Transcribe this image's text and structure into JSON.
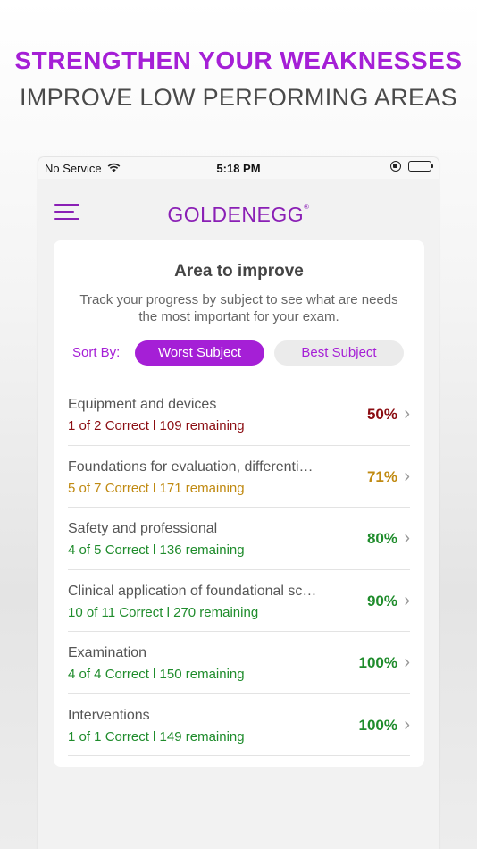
{
  "promo": {
    "headline": "STRENGTHEN YOUR WEAKNESSES",
    "subheadline": "IMPROVE LOW PERFORMING AREAS"
  },
  "status_bar": {
    "carrier": "No Service",
    "time": "5:18 PM"
  },
  "header": {
    "logo": "GOLDENEGG",
    "logo_mark": "®"
  },
  "card": {
    "title": "Area to improve",
    "description": "Track your progress by subject to see what are needs the most important for your exam.",
    "sort_label": "Sort By:",
    "sort_options": [
      "Worst Subject",
      "Best Subject"
    ],
    "selected_sort": "Worst Subject"
  },
  "subjects": [
    {
      "name": "Equipment and devices",
      "stats": "1 of 2  Correct l 109 remaining",
      "percent": "50%",
      "color": "#8b0d12"
    },
    {
      "name": "Foundations for evaluation, differenti…",
      "stats": "5 of 7  Correct l 171 remaining",
      "percent": "71%",
      "color": "#c08a12"
    },
    {
      "name": "Safety and professional",
      "stats": "4 of 5  Correct l 136 remaining",
      "percent": "80%",
      "color": "#1f8c2c"
    },
    {
      "name": "Clinical application of foundational sc…",
      "stats": "10 of 11  Correct l 270 remaining",
      "percent": "90%",
      "color": "#1f8c2c"
    },
    {
      "name": "Examination",
      "stats": "4 of 4  Correct l 150 remaining",
      "percent": "100%",
      "color": "#1f8c2c"
    },
    {
      "name": "Interventions",
      "stats": "1 of 1  Correct l 149 remaining",
      "percent": "100%",
      "color": "#1f8c2c"
    }
  ],
  "colors": {
    "accent": "#a51fd6",
    "logo": "#8a1fb5"
  },
  "icons": {
    "menu": "hamburger-menu-icon",
    "wifi": "wifi-icon",
    "rotation_lock": "rotation-lock-icon",
    "battery": "battery-icon",
    "chevron": "chevron-right-icon"
  }
}
